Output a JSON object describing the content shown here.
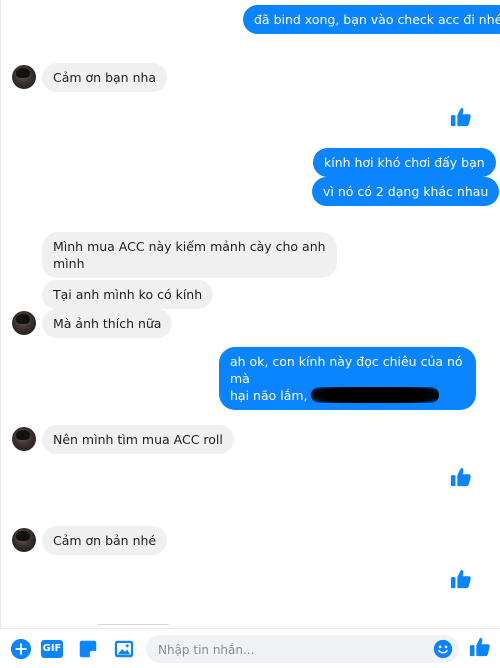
{
  "messages": {
    "m1": "đã bind xong, bạn vào check acc đi nhé",
    "m2": "Cảm ơn bạn nha",
    "m3": "kính hơi khó chơi đấy bạn",
    "m4": "vì nó có 2 dạng khác nhau",
    "m5_line1": "Mình mua ACC này kiếm mảnh cày cho anh",
    "m5_line2": "mình",
    "m6": "Tại anh mình ko có kính",
    "m7": "Mà ảnh thích nữa",
    "m8_line1": "ah ok, con kính này đọc chiêu của nó mà",
    "m8_line2": "hại não lắm, b",
    "m9": "Nên mình tìm mua ACC roll",
    "m10": "Cảm ơn bản nhé"
  },
  "composer": {
    "placeholder": "Nhập tin nhắn...",
    "gif_label": "GIF"
  },
  "colors": {
    "outgoing": "#0a84ff",
    "incoming": "#f0f0f0",
    "accent": "#0a84ff"
  },
  "icons": [
    "thumbs-up-icon",
    "plus-icon",
    "gif-icon",
    "sticker-icon",
    "image-icon",
    "emoji-icon"
  ]
}
